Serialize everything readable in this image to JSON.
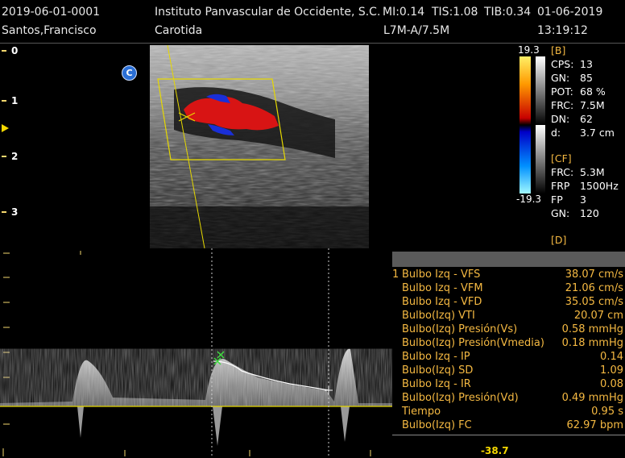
{
  "header": {
    "patient_id": "2019-06-01-0001",
    "patient_name": "Santos,Francisco",
    "institution": "Instituto Panvascular de Occidente, S.C.",
    "mi": "MI:0.14",
    "tis": "TIS:1.08",
    "tib": "TIB:0.34",
    "date": "01-06-2019",
    "exam": "Carotida",
    "probe": "L7M-A/7.5M",
    "time": "13:19:12"
  },
  "depth_scale": {
    "labels": [
      "0",
      "1",
      "2",
      "3"
    ]
  },
  "mode_badge": "C",
  "color_scale": {
    "max": "19.3",
    "min": "-19.3"
  },
  "b_mode": {
    "title": "[B]",
    "params": [
      {
        "key": "CPS:",
        "value": "13"
      },
      {
        "key": "GN:",
        "value": "85"
      },
      {
        "key": "POT:",
        "value": "68 %"
      },
      {
        "key": "FRC:",
        "value": "7.5M"
      },
      {
        "key": "DN:",
        "value": "62"
      },
      {
        "key": "d:",
        "value": "3.7 cm"
      }
    ]
  },
  "cf_mode": {
    "title": "[CF]",
    "params": [
      {
        "key": "FRC:",
        "value": "5.3M"
      },
      {
        "key": "FRP",
        "value": "1500Hz"
      },
      {
        "key": "FP",
        "value": "3"
      },
      {
        "key": "GN:",
        "value": "120"
      }
    ]
  },
  "d_mode": {
    "title": "[D]"
  },
  "measurements": [
    {
      "index": "1",
      "label": "Bulbo Izq - VFS",
      "value": "38.07 cm/s"
    },
    {
      "index": "",
      "label": "Bulbo Izq - VFM",
      "value": "21.06 cm/s"
    },
    {
      "index": "",
      "label": "Bulbo Izq - VFD",
      "value": "35.05 cm/s"
    },
    {
      "index": "",
      "label": "Bulbo(Izq) VTI",
      "value": "20.07 cm"
    },
    {
      "index": "",
      "label": "Bulbo(Izq) Presión(Vs)",
      "value": "0.58 mmHg"
    },
    {
      "index": "",
      "label": "Bulbo(Izq) Presión(Vmedia)",
      "value": "0.18 mmHg"
    },
    {
      "index": "",
      "label": "Bulbo Izq - IP",
      "value": "0.14"
    },
    {
      "index": "",
      "label": "Bulbo(Izq) SD",
      "value": "1.09"
    },
    {
      "index": "",
      "label": "Bulbo Izq - IR",
      "value": "0.08"
    },
    {
      "index": "",
      "label": "Bulbo(Izq) Presión(Vd)",
      "value": "0.49 mmHg"
    },
    {
      "index": "",
      "label": "Tiempo",
      "value": "0.95 s"
    },
    {
      "index": "",
      "label": "Bulbo(Izq) FC",
      "value": "62.97 bpm"
    }
  ],
  "doppler_scale_bottom": "-38.7",
  "colors": {
    "accent_yellow": "#f5d800",
    "measurement_text": "#f5b942",
    "flow_red": "#d81414",
    "flow_blue": "#1a2fd8"
  }
}
